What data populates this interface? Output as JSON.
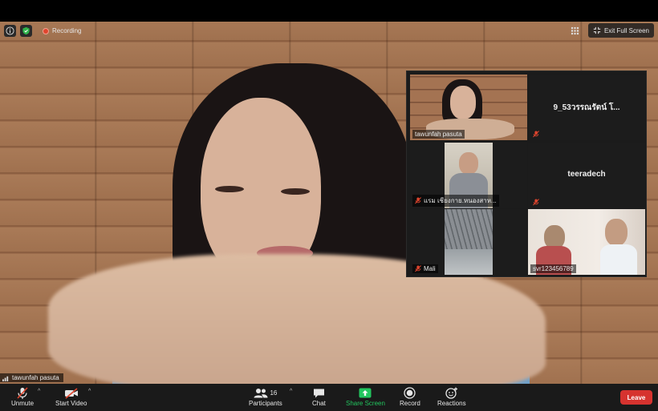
{
  "window": {
    "recording_label": "Recording",
    "exit_fullscreen_label": "Exit Full Screen"
  },
  "main_speaker": {
    "name": "tawunfah pasuta"
  },
  "gallery": {
    "tiles": [
      {
        "name": "tawunfah pasuta",
        "muted": false,
        "video": true
      },
      {
        "name": "9_53วรรณรัตน์ โ...",
        "muted": true,
        "video": false
      },
      {
        "name": "แรม เชียงกาย.หนองสาห...",
        "muted": true,
        "video": true
      },
      {
        "name": "teeradech",
        "muted": true,
        "video": false
      },
      {
        "name": "Mali",
        "muted": true,
        "video": true
      },
      {
        "name": "svr123456789",
        "muted": false,
        "video": true
      }
    ]
  },
  "toolbar": {
    "unmute_label": "Unmute",
    "start_video_label": "Start Video",
    "participants_label": "Participants",
    "participants_count": "16",
    "chat_label": "Chat",
    "share_screen_label": "Share Screen",
    "record_label": "Record",
    "reactions_label": "Reactions",
    "leave_label": "Leave"
  },
  "colors": {
    "accent_green": "#22c55e",
    "leave_red": "#d6332f",
    "active_speaker": "#c7dc3c",
    "muted_red": "#e0452e"
  }
}
